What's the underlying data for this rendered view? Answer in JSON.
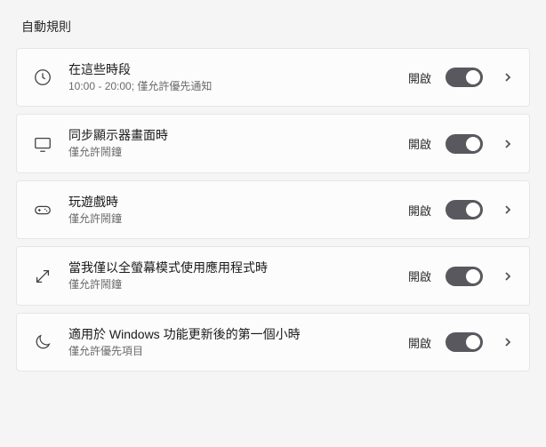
{
  "section_title": "自動規則",
  "status_on": "開啟",
  "rules": [
    {
      "icon": "clock",
      "title": "在這些時段",
      "subtitle": "10:00 - 20:00; 僅允許優先通知"
    },
    {
      "icon": "monitor",
      "title": "同步顯示器畫面時",
      "subtitle": "僅允許鬧鐘"
    },
    {
      "icon": "gamepad",
      "title": "玩遊戲時",
      "subtitle": "僅允許鬧鐘"
    },
    {
      "icon": "fullscreen",
      "title": "當我僅以全螢幕模式使用應用程式時",
      "subtitle": "僅允許鬧鐘"
    },
    {
      "icon": "moon",
      "title": "適用於 Windows 功能更新後的第一個小時",
      "subtitle": "僅允許優先項目"
    }
  ]
}
